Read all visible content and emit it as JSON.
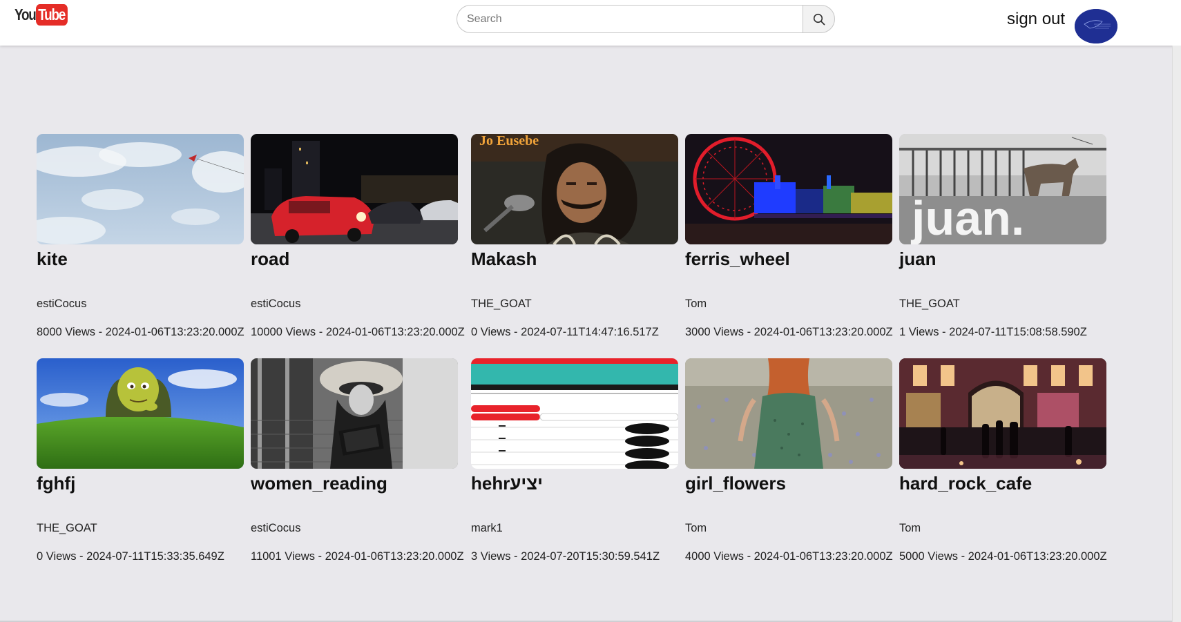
{
  "header": {
    "logo_you": "You",
    "logo_tube": "Tube",
    "search_placeholder": "Search",
    "sign_out_label": "sign out"
  },
  "videos": [
    {
      "title": "kite",
      "author": "estiCocus",
      "views": "8000",
      "date": "2024-01-06T13:23:20.000Z",
      "meta": "8000 Views - 2024-01-06T13:23:20.000Z"
    },
    {
      "title": "road",
      "author": "estiCocus",
      "views": "10000",
      "date": "2024-01-06T13:23:20.000Z",
      "meta": "10000 Views - 2024-01-06T13:23:20.000Z"
    },
    {
      "title": "Makash",
      "author": "THE_GOAT",
      "views": "0",
      "date": "2024-07-11T14:47:16.517Z",
      "meta": "0 Views - 2024-07-11T14:47:16.517Z",
      "thumb_text": "Jo Eusebe"
    },
    {
      "title": "ferris_wheel",
      "author": "Tom",
      "views": "3000",
      "date": "2024-01-06T13:23:20.000Z",
      "meta": "3000 Views - 2024-01-06T13:23:20.000Z"
    },
    {
      "title": "juan",
      "author": "THE_GOAT",
      "views": "1",
      "date": "2024-07-11T15:08:58.590Z",
      "meta": "1 Views - 2024-07-11T15:08:58.590Z",
      "thumb_text": "juan."
    },
    {
      "title": "fghfj",
      "author": "THE_GOAT",
      "views": "0",
      "date": "2024-07-11T15:33:35.649Z",
      "meta": "0 Views - 2024-07-11T15:33:35.649Z"
    },
    {
      "title": "women_reading",
      "author": "estiCocus",
      "views": "11001",
      "date": "2024-01-06T13:23:20.000Z",
      "meta": "11001 Views - 2024-01-06T13:23:20.000Z"
    },
    {
      "title": "hehrיציע",
      "author": "mark1",
      "views": "3",
      "date": "2024-07-20T15:30:59.541Z",
      "meta": "3 Views - 2024-07-20T15:30:59.541Z"
    },
    {
      "title": "girl_flowers",
      "author": "Tom",
      "views": "4000",
      "date": "2024-01-06T13:23:20.000Z",
      "meta": "4000 Views - 2024-01-06T13:23:20.000Z"
    },
    {
      "title": "hard_rock_cafe",
      "author": "Tom",
      "views": "5000",
      "date": "2024-01-06T13:23:20.000Z",
      "meta": "5000 Views - 2024-01-06T13:23:20.000Z"
    }
  ],
  "icons": {
    "search": "search-icon",
    "avatar": "avatar-image"
  },
  "colors": {
    "page_background": "#e9e8ec",
    "logo_red": "#e52d27",
    "avatar_blue": "#1f2f93"
  }
}
